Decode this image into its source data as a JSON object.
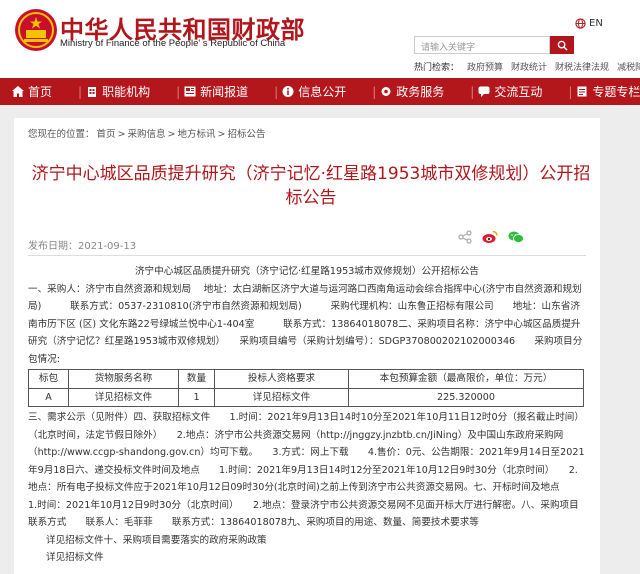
{
  "header": {
    "title_cn": "中华人民共和国财政部",
    "title_en": "Ministry of Finance of the People' s Republic of China",
    "lang_label": "EN",
    "search_placeholder": "请输入关键字",
    "hot_label": "热门检索：",
    "hot_links": [
      "政府预算",
      "财政统计",
      "财税法律法规",
      "减税降费"
    ]
  },
  "nav": [
    "首页",
    "职能机构",
    "新闻报道",
    "信息公开",
    "政务服务",
    "交流互动",
    "专题专栏"
  ],
  "breadcrumb": {
    "prefix": "您现在的位置：",
    "items": [
      "首页",
      "采购信息",
      "地方标讯",
      "招标公告"
    ],
    "sep": ">"
  },
  "article": {
    "title": "济宁中心城区品质提升研究（济宁记忆·红星路1953城市双修规划）公开招标公告",
    "publish_label": "发布日期：",
    "publish_date": "2021-09-13",
    "sub_title": "济宁中心城区品质提升研究（济宁记忆·红星路1953城市双修规划）公开招标公告",
    "para1": "一、采购人：济宁市自然资源和规划局　 地址：太白湖新区济宁大道与运河路口西南角运动会综合指挥中心(济宁市自然资源和规划局)　　　联系方式：0537-2310810(济宁市自然资源和规划局)　　　采购代理机构：山东鲁正招标有限公司　　地址：山东省济南市历下区 (区) 文化东路22号绿城兰悦中心1-404室　　　联系方式：13864018078二、采购项目名称：济宁中心城区品质提升研究（济宁记忆？红星路1953城市双修规划）　　采购项目编号（采购计划编号）：SDGP370800202102000346　　采购项目分包情况:",
    "table_header": [
      "标包",
      "货物服务名称",
      "数量",
      "投标人资格要求",
      "本包预算金额（最高限价，单位：万元）"
    ],
    "table_row": [
      "A",
      "详见招标文件",
      "1",
      "详见招标文件",
      "225.320000"
    ],
    "para2": "三、需求公示（见附件）四、获取招标文件　　1.时间：2021年9月13日14时10分至2021年10月11日12时0分（报名截止时间）（北京时间，法定节假日除外）　　2.地点：济宁市公共资源交易网（http://jnggzy.jnzbtb.cn/JiNing）及中国山东政府采购网（http://www.ccgp-shandong.gov.cn）均可下载。　　3.方式：网上下载　　4.售价：0元、公告期限：2021年9月14日至2021年9月18日六、递交投标文件时间及地点　　1.时间：2021年9月13日14时12分至2021年10月12日9时30分（北京时间）　　2.地点：所有电子投标文件应于2021年10月12日09时30分(北京时间)之前上传到济宁市公共资源交易网。七、开标时间及地点　　1.时间：2021年10月12日9时30分（北京时间）　　2.地点：登录济宁市公共资源交易网不见面开标大厅进行解密。八、采购项目联系方式　　联系人：毛菲菲　　联系方式：13864018078九、采购项目的用途、数量、简要技术要求等",
    "line3": "详见招标文件十、采购项目需要落实的政府采购政策",
    "line4": "详见招标文件"
  }
}
